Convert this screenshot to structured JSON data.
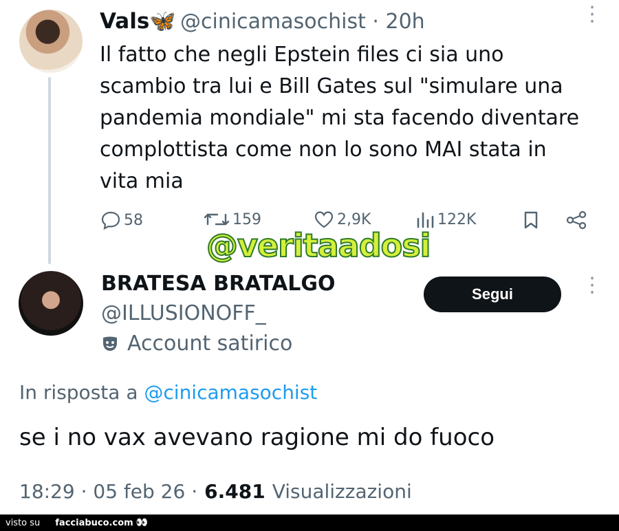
{
  "tweet": {
    "name": "Vals",
    "name_emoji": "🦋",
    "handle_time": "@cinicamasochist · 20h",
    "text": "Il fatto che negli Epstein files ci sia uno scambio tra lui e Bill Gates sul \"simulare una pandemia mondiale\" mi sta facendo diventare complottista come non lo sono MAI stata in vita mia",
    "replies": "58",
    "retweets": "159",
    "likes": "2,9K",
    "views": "122K",
    "more": "⋮"
  },
  "watermark": "@veritaadosi",
  "reply": {
    "name": "BRATESA BRATALGO",
    "handle": "@ILLUSIONOFF_",
    "label": "Account satirico",
    "follow": "Segui",
    "more": "⋮",
    "in_reply_prefix": "In risposta a",
    "in_reply_mention": "@cinicamasochist",
    "text": "se i no vax avevano ragione mi do fuoco",
    "time": "18:29 · 05 feb 26 ·",
    "view_count": "6.481",
    "views_label": "Visualizzazioni"
  },
  "footer": {
    "prefix": "visto su",
    "site": "facciabuco.com",
    "eyes": "👀"
  },
  "colors": {
    "text": "#0f1419",
    "secondary": "#536471",
    "link": "#1d9bf0",
    "button": "#0f1419"
  }
}
